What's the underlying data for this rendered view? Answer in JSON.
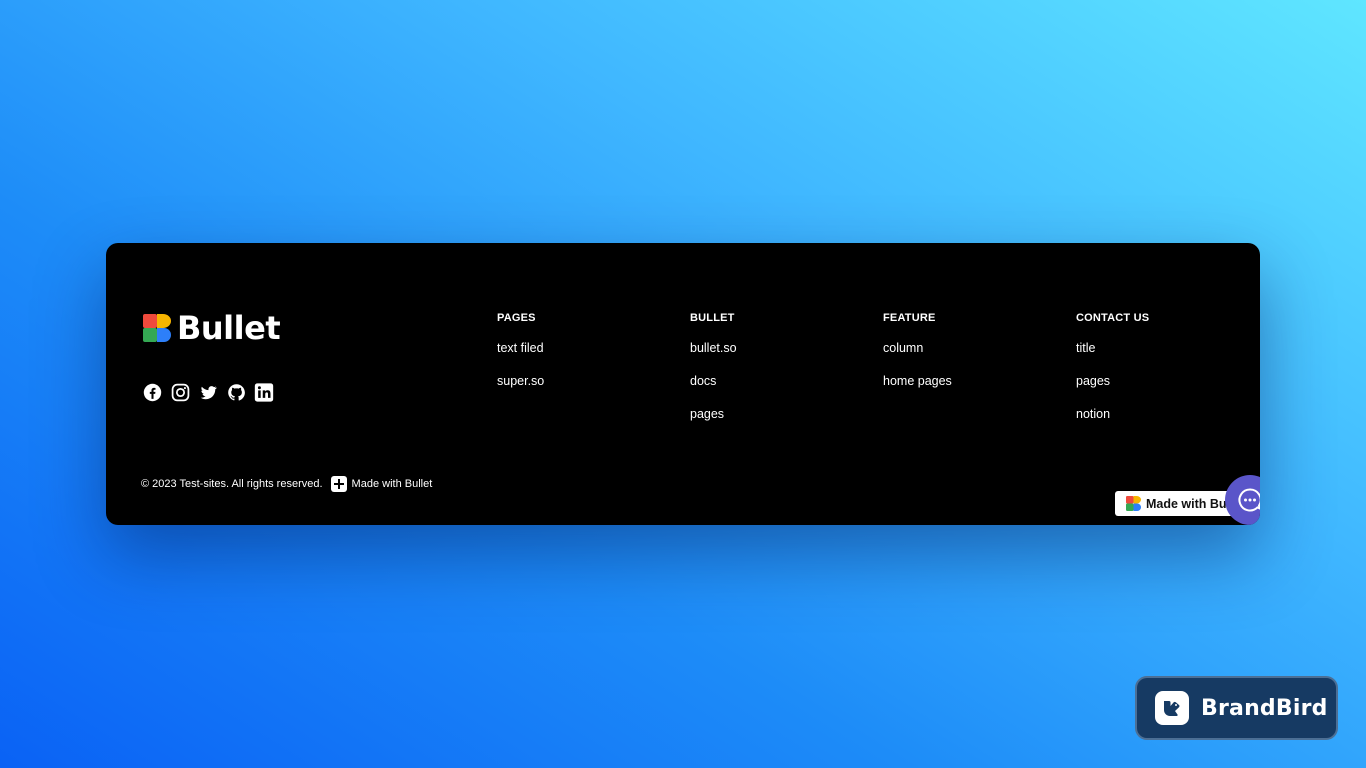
{
  "brand": {
    "name": "Bullet",
    "mark_colors": [
      "#ef4a3c",
      "#f7b500",
      "#34a853",
      "#2d7ff9"
    ]
  },
  "socials": [
    {
      "name": "facebook-icon"
    },
    {
      "name": "instagram-icon"
    },
    {
      "name": "twitter-icon"
    },
    {
      "name": "github-icon"
    },
    {
      "name": "linkedin-icon"
    }
  ],
  "columns": [
    {
      "title": "PAGES",
      "links": [
        "text filed",
        "super.so"
      ]
    },
    {
      "title": "BULLET",
      "links": [
        "bullet.so",
        "docs",
        "pages"
      ]
    },
    {
      "title": "FEATURE",
      "links": [
        "column",
        "home pages"
      ]
    },
    {
      "title": "CONTACT US",
      "links": [
        "title",
        "pages",
        "notion"
      ]
    }
  ],
  "footer": {
    "copyright": "© 2023 Test-sites. All rights reserved.",
    "made_with": "Made with Bullet"
  },
  "badge": {
    "label": "Made with Bullet"
  },
  "chat": {
    "icon": "chat-ellipsis-icon",
    "color": "#5a55c9"
  },
  "watermark": {
    "label": "BrandBird",
    "background": "#163a63"
  }
}
